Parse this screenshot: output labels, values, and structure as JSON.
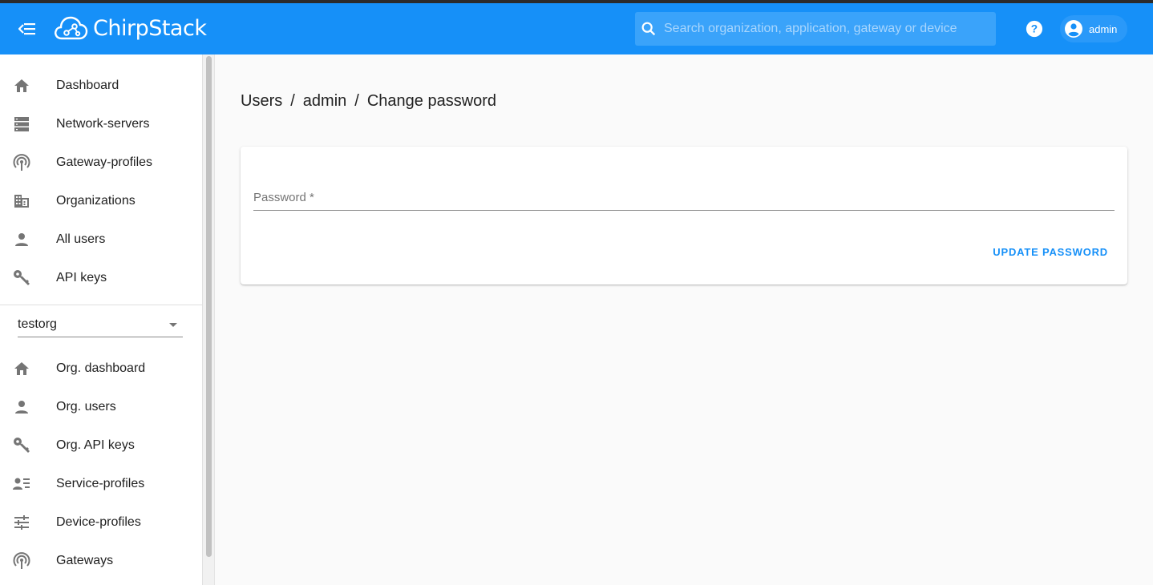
{
  "header": {
    "app_name": "ChirpStack",
    "search_placeholder": "Search organization, application, gateway or device",
    "username": "admin",
    "brand_color": "#1690f8"
  },
  "sidebar": {
    "global_items": [
      {
        "label": "Dashboard",
        "icon": "home-icon"
      },
      {
        "label": "Network-servers",
        "icon": "server-icon"
      },
      {
        "label": "Gateway-profiles",
        "icon": "antenna-icon"
      },
      {
        "label": "Organizations",
        "icon": "domain-icon"
      },
      {
        "label": "All users",
        "icon": "person-icon"
      },
      {
        "label": "API keys",
        "icon": "key-icon"
      }
    ],
    "org_selector": {
      "value": "testorg"
    },
    "org_items": [
      {
        "label": "Org. dashboard",
        "icon": "home-icon"
      },
      {
        "label": "Org. users",
        "icon": "person-icon"
      },
      {
        "label": "Org. API keys",
        "icon": "key-icon"
      },
      {
        "label": "Service-profiles",
        "icon": "account-details-icon"
      },
      {
        "label": "Device-profiles",
        "icon": "tune-icon"
      },
      {
        "label": "Gateways",
        "icon": "antenna-icon"
      }
    ]
  },
  "breadcrumb": {
    "items": [
      "Users",
      "admin",
      "Change password"
    ],
    "separator": "/"
  },
  "form": {
    "password_label": "Password *",
    "password_value": "",
    "submit_label": "UPDATE PASSWORD"
  }
}
